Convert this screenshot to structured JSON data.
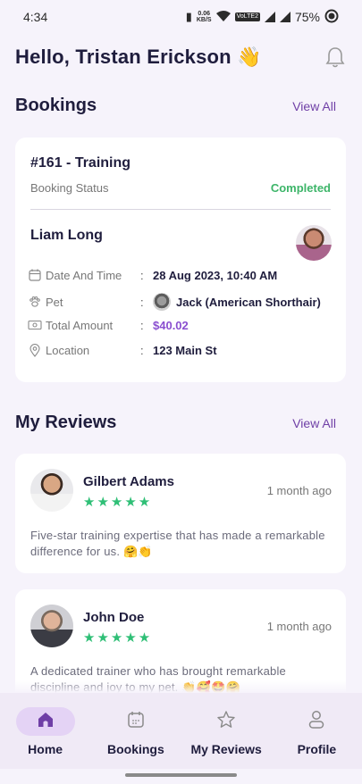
{
  "status_bar": {
    "time": "4:34",
    "net_speed_value": "0.06",
    "net_speed_unit": "KB/S",
    "volte": "VoLTE2",
    "battery": "75%"
  },
  "header": {
    "greeting": "Hello, Tristan Erickson 👋"
  },
  "bookings": {
    "title": "Bookings",
    "view_all": "View All",
    "card": {
      "title": "#161 - Training",
      "status_label": "Booking Status",
      "status_value": "Completed",
      "customer_name": "Liam Long",
      "rows": [
        {
          "icon": "calendar-icon",
          "label": "Date And Time",
          "colon": ":",
          "value": "28 Aug 2023, 10:40 AM"
        },
        {
          "icon": "paw-icon",
          "label": "Pet",
          "colon": ":",
          "value": "Jack (American Shorthair)"
        },
        {
          "icon": "money-icon",
          "label": "Total Amount",
          "colon": ":",
          "value": "$40.02"
        },
        {
          "icon": "location-icon",
          "label": "Location",
          "colon": ":",
          "value": "123 Main St"
        }
      ]
    }
  },
  "reviews": {
    "title": "My Reviews",
    "view_all": "View All",
    "items": [
      {
        "name": "Gilbert Adams",
        "stars": "★★★★★",
        "time": "1 month ago",
        "text": "Five-star training expertise that has made a remarkable difference for us. 🤗👏"
      },
      {
        "name": "John Doe",
        "stars": "★★★★★",
        "time": "1 month ago",
        "text": "A dedicated trainer who has brought remarkable discipline and joy to my pet. 👏🥰🤩🤗"
      }
    ]
  },
  "bottom_nav": {
    "items": [
      {
        "label": "Home",
        "icon": "home-icon",
        "active": true
      },
      {
        "label": "Bookings",
        "icon": "calendar-icon",
        "active": false
      },
      {
        "label": "My Reviews",
        "icon": "star-icon",
        "active": false
      },
      {
        "label": "Profile",
        "icon": "profile-icon",
        "active": false
      }
    ]
  },
  "colors": {
    "accent": "#6f3fa6",
    "status_completed": "#3db569",
    "price": "#8a4fd0",
    "stars": "#2fbf76",
    "background": "#f6f3fb"
  }
}
